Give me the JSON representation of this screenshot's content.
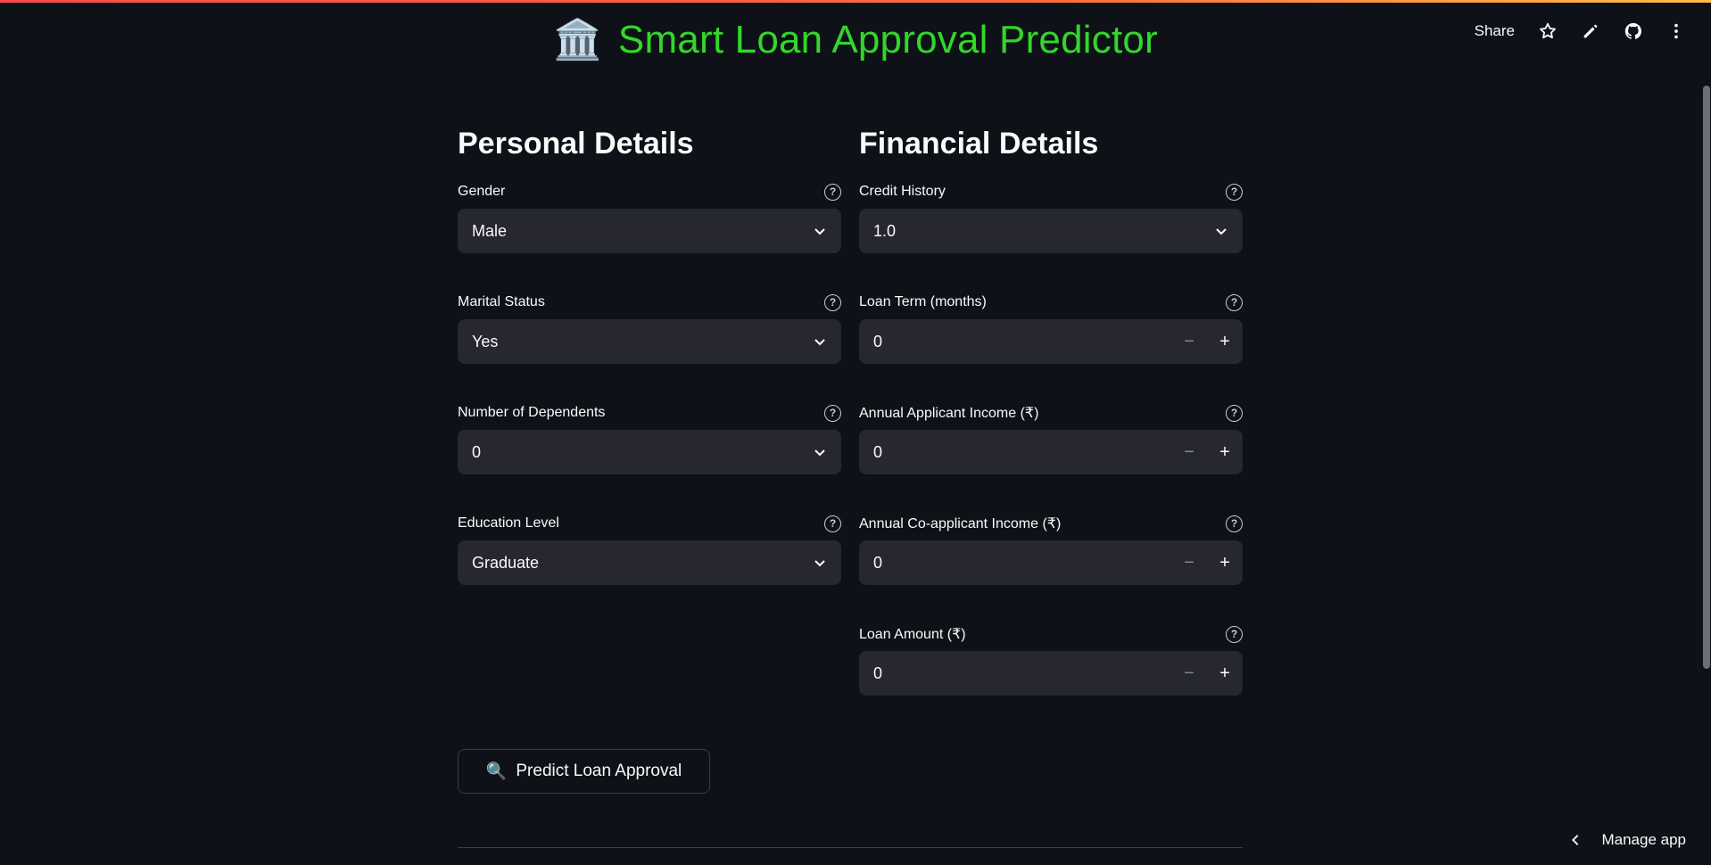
{
  "header": {
    "logo_glyph": "🏛️",
    "title": "Smart Loan Approval Predictor",
    "title_color": "#33d62a"
  },
  "toolbar": {
    "share_label": "Share"
  },
  "personal": {
    "heading": "Personal Details",
    "fields": [
      {
        "label": "Gender",
        "value": "Male",
        "type": "select"
      },
      {
        "label": "Marital Status",
        "value": "Yes",
        "type": "select"
      },
      {
        "label": "Number of Dependents",
        "value": "0",
        "type": "select"
      },
      {
        "label": "Education Level",
        "value": "Graduate",
        "type": "select"
      }
    ]
  },
  "financial": {
    "heading": "Financial Details",
    "fields": [
      {
        "label": "Credit History",
        "value": "1.0",
        "type": "select"
      },
      {
        "label": "Loan Term (months)",
        "value": "0",
        "type": "number"
      },
      {
        "label": "Annual Applicant Income (₹)",
        "value": "0",
        "type": "number"
      },
      {
        "label": "Annual Co-applicant Income (₹)",
        "value": "0",
        "type": "number"
      },
      {
        "label": "Loan Amount (₹)",
        "value": "0",
        "type": "number"
      }
    ]
  },
  "predict_button": {
    "icon": "🔍",
    "label": "Predict Loan Approval"
  },
  "footer": {
    "manage_app_label": "Manage app"
  },
  "help_glyph": "?",
  "stepper": {
    "minus": "−",
    "plus": "+"
  }
}
